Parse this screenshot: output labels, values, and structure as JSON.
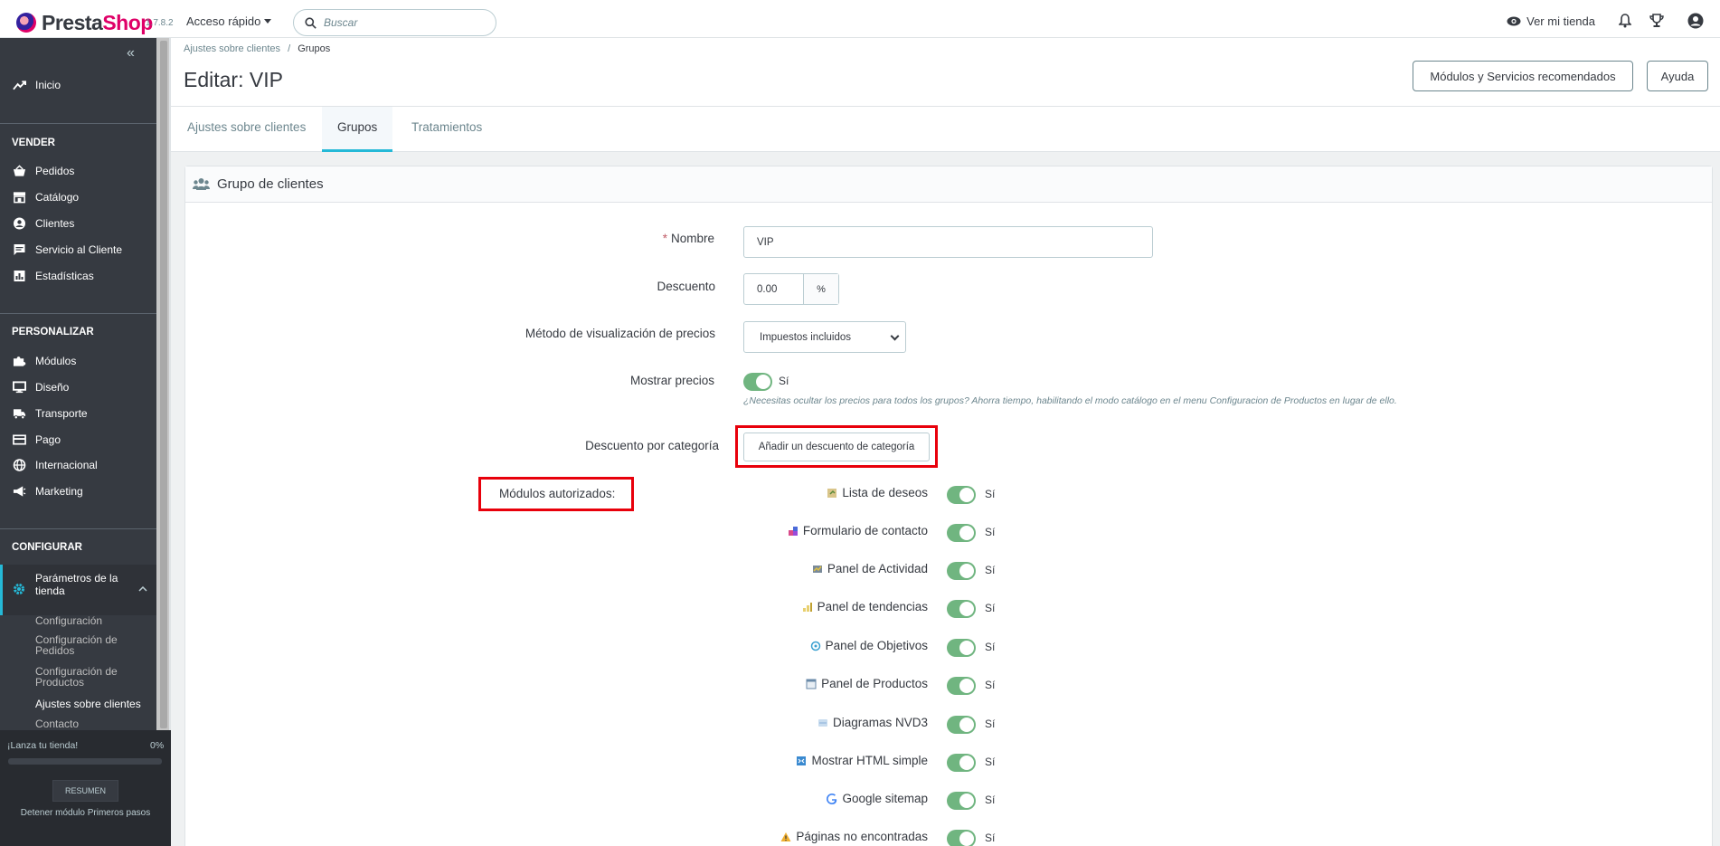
{
  "header": {
    "logo_text_a": "Presta",
    "logo_text_b": "Shop",
    "version": "1.7.8.2",
    "quick_access": "Acceso rápido",
    "search_placeholder": "Buscar",
    "view_store": "Ver mi tienda"
  },
  "sidebar": {
    "inicio": "Inicio",
    "section_sell": "VENDER",
    "sell_items": [
      "Pedidos",
      "Catálogo",
      "Clientes",
      "Servicio al Cliente",
      "Estadísticas"
    ],
    "section_customize": "PERSONALIZAR",
    "customize_items": [
      "Módulos",
      "Diseño",
      "Transporte",
      "Pago",
      "Internacional",
      "Marketing"
    ],
    "section_configure": "CONFIGURAR",
    "active_item_line1": "Parámetros de la",
    "active_item_line2": "tienda",
    "sub_items": [
      {
        "l1": "Configuración",
        "l2": ""
      },
      {
        "l1": "Configuración de",
        "l2": "Pedidos"
      },
      {
        "l1": "Configuración de",
        "l2": "Productos"
      },
      {
        "l1": "Ajustes sobre clientes",
        "l2": ""
      },
      {
        "l1": "Contacto",
        "l2": ""
      }
    ],
    "launch_label": "¡Lanza tu tienda!",
    "launch_pct": "0%",
    "launch_progress": 0,
    "resumen": "RESUMEN",
    "detener": "Detener módulo Primeros pasos"
  },
  "page": {
    "breadcrumb_parent": "Ajustes sobre clientes",
    "breadcrumb_sep": "/",
    "breadcrumb_current": "Grupos",
    "title": "Editar: VIP",
    "btn_modules": "Módulos y Servicios recomendados",
    "btn_help": "Ayuda",
    "tabs": [
      "Ajustes sobre clientes",
      "Grupos",
      "Tratamientos"
    ]
  },
  "form": {
    "card_title": "Grupo de clientes",
    "name_label": "Nombre",
    "name_required": "*",
    "name_value": "VIP",
    "discount_label": "Descuento",
    "discount_value": "0.00",
    "discount_unit": "%",
    "price_method_label": "Método de visualización de precios",
    "price_method_value": "Impuestos incluidos",
    "show_prices_label": "Mostrar precios",
    "show_prices_value": "Sí",
    "show_prices_help": "¿Necesitas ocultar los precios para todos los grupos? Ahorra tiempo, habilitando el modo catálogo en el menu Configuracion de Productos en lugar de ello.",
    "cat_discount_label": "Descuento por categoría",
    "cat_discount_button": "Añadir un descuento de categoría",
    "modules_label": "Módulos autorizados:",
    "modules": [
      {
        "name": "Lista de deseos",
        "value": "Sí",
        "icon": "wishlist-icon"
      },
      {
        "name": "Formulario de contacto",
        "value": "Sí",
        "icon": "contact-form-icon"
      },
      {
        "name": "Panel de Actividad",
        "value": "Sí",
        "icon": "activity-icon"
      },
      {
        "name": "Panel de tendencias",
        "value": "Sí",
        "icon": "trends-icon"
      },
      {
        "name": "Panel de Objetivos",
        "value": "Sí",
        "icon": "goals-icon"
      },
      {
        "name": "Panel de Productos",
        "value": "Sí",
        "icon": "products-icon"
      },
      {
        "name": "Diagramas NVD3",
        "value": "Sí",
        "icon": "nvd3-icon"
      },
      {
        "name": "Mostrar HTML simple",
        "value": "Sí",
        "icon": "html-icon"
      },
      {
        "name": "Google sitemap",
        "value": "Sí",
        "icon": "google-icon"
      },
      {
        "name": "Páginas no encontradas",
        "value": "Sí",
        "icon": "warning-icon"
      }
    ]
  },
  "colors": {
    "accent": "#25b9d7",
    "toggle_on": "#70b580",
    "sidebar_bg": "#363a41",
    "highlight_box": "#e8000b"
  }
}
